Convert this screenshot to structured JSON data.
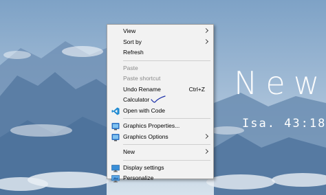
{
  "wallpaper": {
    "title": "New",
    "verse": "Isa. 43:18"
  },
  "context_menu": {
    "items": [
      {
        "label": "View",
        "submenu": true
      },
      {
        "label": "Sort by",
        "submenu": true
      },
      {
        "label": "Refresh"
      },
      {
        "label": "Paste",
        "disabled": true
      },
      {
        "label": "Paste shortcut",
        "disabled": true
      },
      {
        "label": "Undo Rename",
        "shortcut": "Ctrl+Z"
      },
      {
        "label": "Calculator",
        "annotation": "checkmark"
      },
      {
        "label": "Open with Code",
        "icon": "vscode-icon"
      },
      {
        "label": "Graphics Properties...",
        "icon": "intel-graphics-icon"
      },
      {
        "label": "Graphics Options",
        "icon": "intel-graphics-icon",
        "submenu": true
      },
      {
        "label": "New",
        "submenu": true
      },
      {
        "label": "Display settings",
        "icon": "display-icon"
      },
      {
        "label": "Personalize",
        "icon": "personalize-icon"
      }
    ]
  },
  "colors": {
    "sky_top": "#8fb0cf",
    "sky_bottom": "#c9d8e6",
    "mountains": "#5d7fa6",
    "menu_bg": "#f2f2f2",
    "check_ink": "#1a2fa8"
  }
}
